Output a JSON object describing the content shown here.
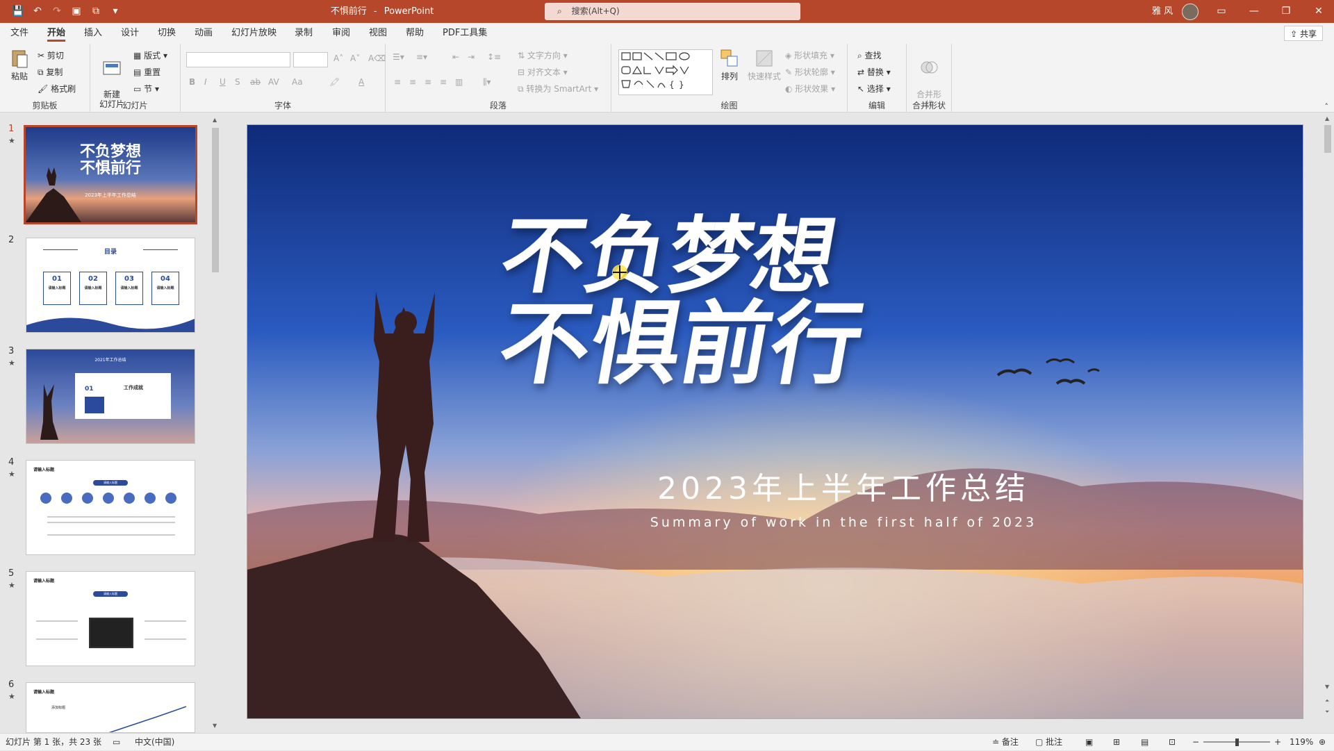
{
  "titlebar": {
    "doc_title": "不惧前行",
    "app_name": "PowerPoint",
    "title_separator": "-",
    "search_placeholder": "搜索(Alt+Q)",
    "user_name": "雅 风",
    "accent_color": "#b7472a"
  },
  "menu": {
    "tabs": [
      "文件",
      "开始",
      "插入",
      "设计",
      "切换",
      "动画",
      "幻灯片放映",
      "录制",
      "审阅",
      "视图",
      "帮助",
      "PDF工具集"
    ],
    "active_tab": "开始",
    "share_label": "共享"
  },
  "ribbon": {
    "clipboard": {
      "label": "剪贴板",
      "paste": "粘贴",
      "cut": "剪切",
      "copy": "复制",
      "format_painter": "格式刷"
    },
    "slides": {
      "label": "幻灯片",
      "new_slide": "新建\n幻灯片",
      "layout": "版式",
      "reset": "重置",
      "section": "节"
    },
    "font": {
      "label": "字体"
    },
    "paragraph": {
      "label": "段落",
      "text_direction": "文字方向",
      "align_text": "对齐文本",
      "convert_smartart": "转换为 SmartArt"
    },
    "drawing": {
      "label": "绘图",
      "arrange": "排列",
      "quick_styles": "快速样式",
      "shape_fill": "形状填充",
      "shape_outline": "形状轮廓",
      "shape_effects": "形状效果"
    },
    "editing": {
      "label": "编辑",
      "find": "查找",
      "replace": "替换",
      "select": "选择"
    },
    "merge": {
      "label": "合并形状",
      "merge_shapes": "合并形\n状"
    }
  },
  "thumbnails": [
    {
      "number": "1",
      "star": "★",
      "title": "不负梦想 不惧前行",
      "sub": "2023年上半年工作总结"
    },
    {
      "number": "2",
      "star": "",
      "title": "目录",
      "items": [
        "01",
        "02",
        "03",
        "04"
      ],
      "item_label": "请输入标题"
    },
    {
      "number": "3",
      "star": "★",
      "title": "2021年工作总结",
      "num": "01",
      "label": "工作成就"
    },
    {
      "number": "4",
      "star": "★",
      "title": "请输入标题",
      "badge": "请输入标题"
    },
    {
      "number": "5",
      "star": "★",
      "title": "请输入标题",
      "badge": "请输入标题"
    },
    {
      "number": "6",
      "star": "★",
      "title": "请输入标题",
      "sub": "添加标题"
    }
  ],
  "slide": {
    "headline_line1": "不负梦想",
    "headline_line2": "不惧前行",
    "subtitle_cn": "2023年上半年工作总结",
    "subtitle_en": "Summary of work in the first half of 2023"
  },
  "status": {
    "slide_info": "幻灯片 第 1 张，共 23 张",
    "language": "中文(中国)",
    "notes": "备注",
    "comments": "批注",
    "zoom": "119%"
  }
}
